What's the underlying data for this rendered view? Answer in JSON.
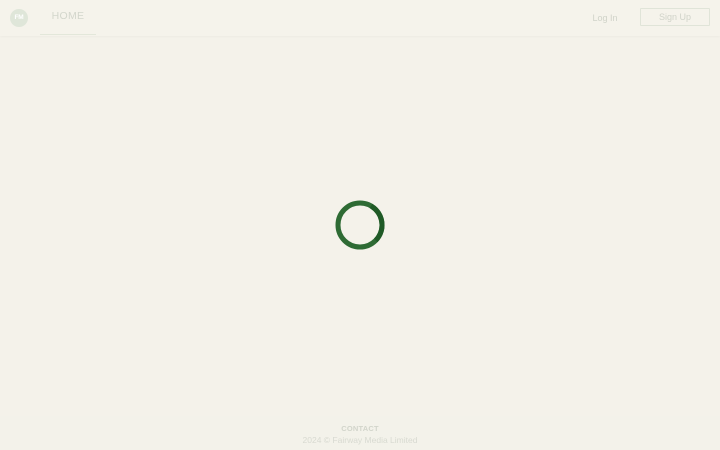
{
  "header": {
    "logo_text": "FM",
    "nav_home": "HOME",
    "login_label": "Log In",
    "signup_label": "Sign Up"
  },
  "loading": {
    "spinner_color": "#1f5a26",
    "spinner_track": "#2e6b34"
  },
  "footer": {
    "contact_label": "CONTACT",
    "copyright": "2024 © Fairway Media Limited"
  },
  "colors": {
    "background": "#f4f2ea",
    "accent": "#1f5a26"
  }
}
